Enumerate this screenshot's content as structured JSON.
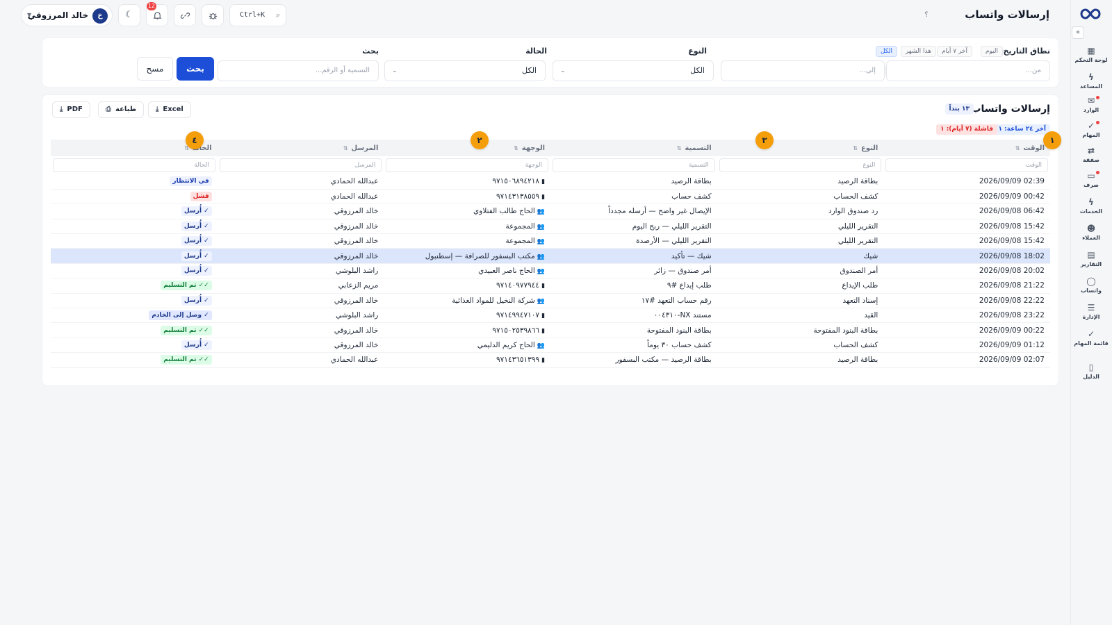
{
  "header": {
    "title": "إرسالات واتساب",
    "help": "؟"
  },
  "user": {
    "name": "خالد المرزوقي",
    "initial": "خ"
  },
  "toolbar": {
    "notifications_count": "12",
    "search_shortcut": "Ctrl+K"
  },
  "sidebar": {
    "items": [
      {
        "label": "لوحة التحكم",
        "icon": "grid-icon"
      },
      {
        "label": "المساعد",
        "icon": "bolt-icon"
      },
      {
        "label": "الوارد",
        "icon": "inbox-icon"
      },
      {
        "label": "المهام",
        "icon": "check-icon"
      },
      {
        "label": "صفقة",
        "icon": "swap-icon"
      },
      {
        "label": "صرف",
        "icon": "cash-icon"
      },
      {
        "label": "الخدمات",
        "icon": "bolt-icon"
      },
      {
        "label": "العملاء",
        "icon": "users-icon"
      },
      {
        "label": "التقارير",
        "icon": "file-icon"
      },
      {
        "label": "واتساب",
        "icon": "chat-icon"
      },
      {
        "label": "الإدارة",
        "icon": "sliders-icon"
      },
      {
        "label": "قائمة المهام",
        "icon": "check-icon"
      },
      {
        "label": "الدليل",
        "icon": "book-icon"
      }
    ]
  },
  "filters": {
    "date_range_label": "نطاق التاريخ",
    "date_chips": [
      "اليوم",
      "آخر ٧ أيام",
      "هذا الشهر",
      "الكل"
    ],
    "active_chip": "الكل",
    "from_placeholder": "من...",
    "to_placeholder": "إلى...",
    "type_label": "النوع",
    "type_value": "الكل",
    "status_label": "الحالة",
    "status_value": "الكل",
    "search_label": "بحث",
    "search_placeholder": "التسمية أو الرقم...",
    "search_button": "بحث",
    "clear_button": "مسح"
  },
  "card": {
    "title": "إرسالات واتساب",
    "count": "١٣ بنداً",
    "last24": "آخر ٢٤ ساعة: ١١",
    "failed7": "فاشلة (٧ أيام): ١",
    "export_excel": "Excel",
    "export_print": "طباعة",
    "export_pdf": "PDF"
  },
  "markers": [
    "١",
    "٢",
    "٣",
    "٤"
  ],
  "table": {
    "columns": [
      "الوقت",
      "النوع",
      "التسمية",
      "الوجهة",
      "المرسل",
      "الحالة"
    ],
    "filter_placeholders": [
      "الوقت",
      "النوع",
      "التسمية",
      "الوجهة",
      "المرسل",
      "الحالة"
    ],
    "rows": [
      {
        "time": "2026/09/09 02:39",
        "type": "بطاقة الرصيد",
        "label": "بطاقة الرصيد",
        "dest": "٩٧١٥٠٦٨٩٤٢١٨",
        "dest_icon": "phone-icon",
        "sender": "عبدالله الحمادي",
        "status": "في الانتظار",
        "status_kind": "pending"
      },
      {
        "time": "2026/09/09 00:42",
        "type": "كشف الحساب",
        "label": "كشف حساب",
        "dest": "٩٧١٤٣١٣٨٥٥٩",
        "dest_icon": "phone-icon",
        "sender": "عبدالله الحمادي",
        "status": "فشل",
        "status_kind": "failed"
      },
      {
        "time": "2026/09/08 06:42",
        "type": "رد صندوق الوارد",
        "label": "الإيصال غير واضح — أرسله مجدداً",
        "dest": "الحاج طالب الفتلاوي",
        "dest_icon": "group-icon",
        "sender": "خالد المرزوقي",
        "status": "✓ أُرسل",
        "status_kind": "sent"
      },
      {
        "time": "2026/09/08 15:42",
        "type": "التقرير الليلي",
        "label": "التقرير الليلي — ربح اليوم",
        "dest": "المجموعة",
        "dest_icon": "group-icon",
        "sender": "خالد المرزوقي",
        "status": "✓ أُرسل",
        "status_kind": "sent"
      },
      {
        "time": "2026/09/08 15:42",
        "type": "التقرير الليلي",
        "label": "التقرير الليلي — الأرصدة",
        "dest": "المجموعة",
        "dest_icon": "group-icon",
        "sender": "خالد المرزوقي",
        "status": "✓ أُرسل",
        "status_kind": "sent"
      },
      {
        "time": "2026/09/08 18:02",
        "type": "شيك",
        "label": "شيك — تأكيد",
        "dest": "مكتب البسفور للصرافة — إسطنبول",
        "dest_icon": "group-icon",
        "sender": "خالد المرزوقي",
        "status": "✓ أُرسل",
        "status_kind": "sent",
        "selected": true
      },
      {
        "time": "2026/09/08 20:02",
        "type": "أمر الصندوق",
        "label": "أمر صندوق — زائر",
        "dest": "الحاج ناصر العبيدي",
        "dest_icon": "group-icon",
        "sender": "راشد البلوشي",
        "status": "✓ أُرسل",
        "status_kind": "sent"
      },
      {
        "time": "2026/09/08 21:22",
        "type": "طلب الإيداع",
        "label": "طلب إيداع #٩",
        "dest": "٩٧١٤٠٩٧٧٩٤٤",
        "dest_icon": "phone-icon",
        "sender": "مريم الزعابي",
        "status": "✓✓ تم التسليم",
        "status_kind": "delivered"
      },
      {
        "time": "2026/09/08 22:22",
        "type": "إسناد التعهد",
        "label": "رقم حساب التعهد #١٧",
        "dest": "شركة النخيل للمواد الغذائية",
        "dest_icon": "group-icon",
        "sender": "خالد المرزوقي",
        "status": "✓ أُرسل",
        "status_kind": "sent"
      },
      {
        "time": "2026/09/08 23:22",
        "type": "القيد",
        "label": "مستند NX-٠٠٤٣١٠",
        "dest": "٩٧١٤٩٩٤٧١٠٧",
        "dest_icon": "phone-icon",
        "sender": "راشد البلوشي",
        "status": "✓ وصل إلى الخادم",
        "status_kind": "server"
      },
      {
        "time": "2026/09/09 00:22",
        "type": "بطاقة البنود المفتوحة",
        "label": "بطاقة البنود المفتوحة",
        "dest": "٩٧١٥٠٢٥٣٩٨٦٦",
        "dest_icon": "phone-icon",
        "sender": "خالد المرزوقي",
        "status": "✓✓ تم التسليم",
        "status_kind": "delivered"
      },
      {
        "time": "2026/09/09 01:12",
        "type": "كشف الحساب",
        "label": "كشف حساب ٣٠ يوماً",
        "dest": "الحاج كريم الدليمي",
        "dest_icon": "group-icon",
        "sender": "خالد المرزوقي",
        "status": "✓ أُرسل",
        "status_kind": "sent"
      },
      {
        "time": "2026/09/09 02:07",
        "type": "بطاقة الرصيد",
        "label": "بطاقة الرصيد — مكتب البسفور",
        "dest": "٩٧١٤٣٦٥١٣٩٩",
        "dest_icon": "phone-icon",
        "sender": "عبدالله الحمادي",
        "status": "✓✓ تم التسليم",
        "status_kind": "delivered"
      }
    ]
  }
}
